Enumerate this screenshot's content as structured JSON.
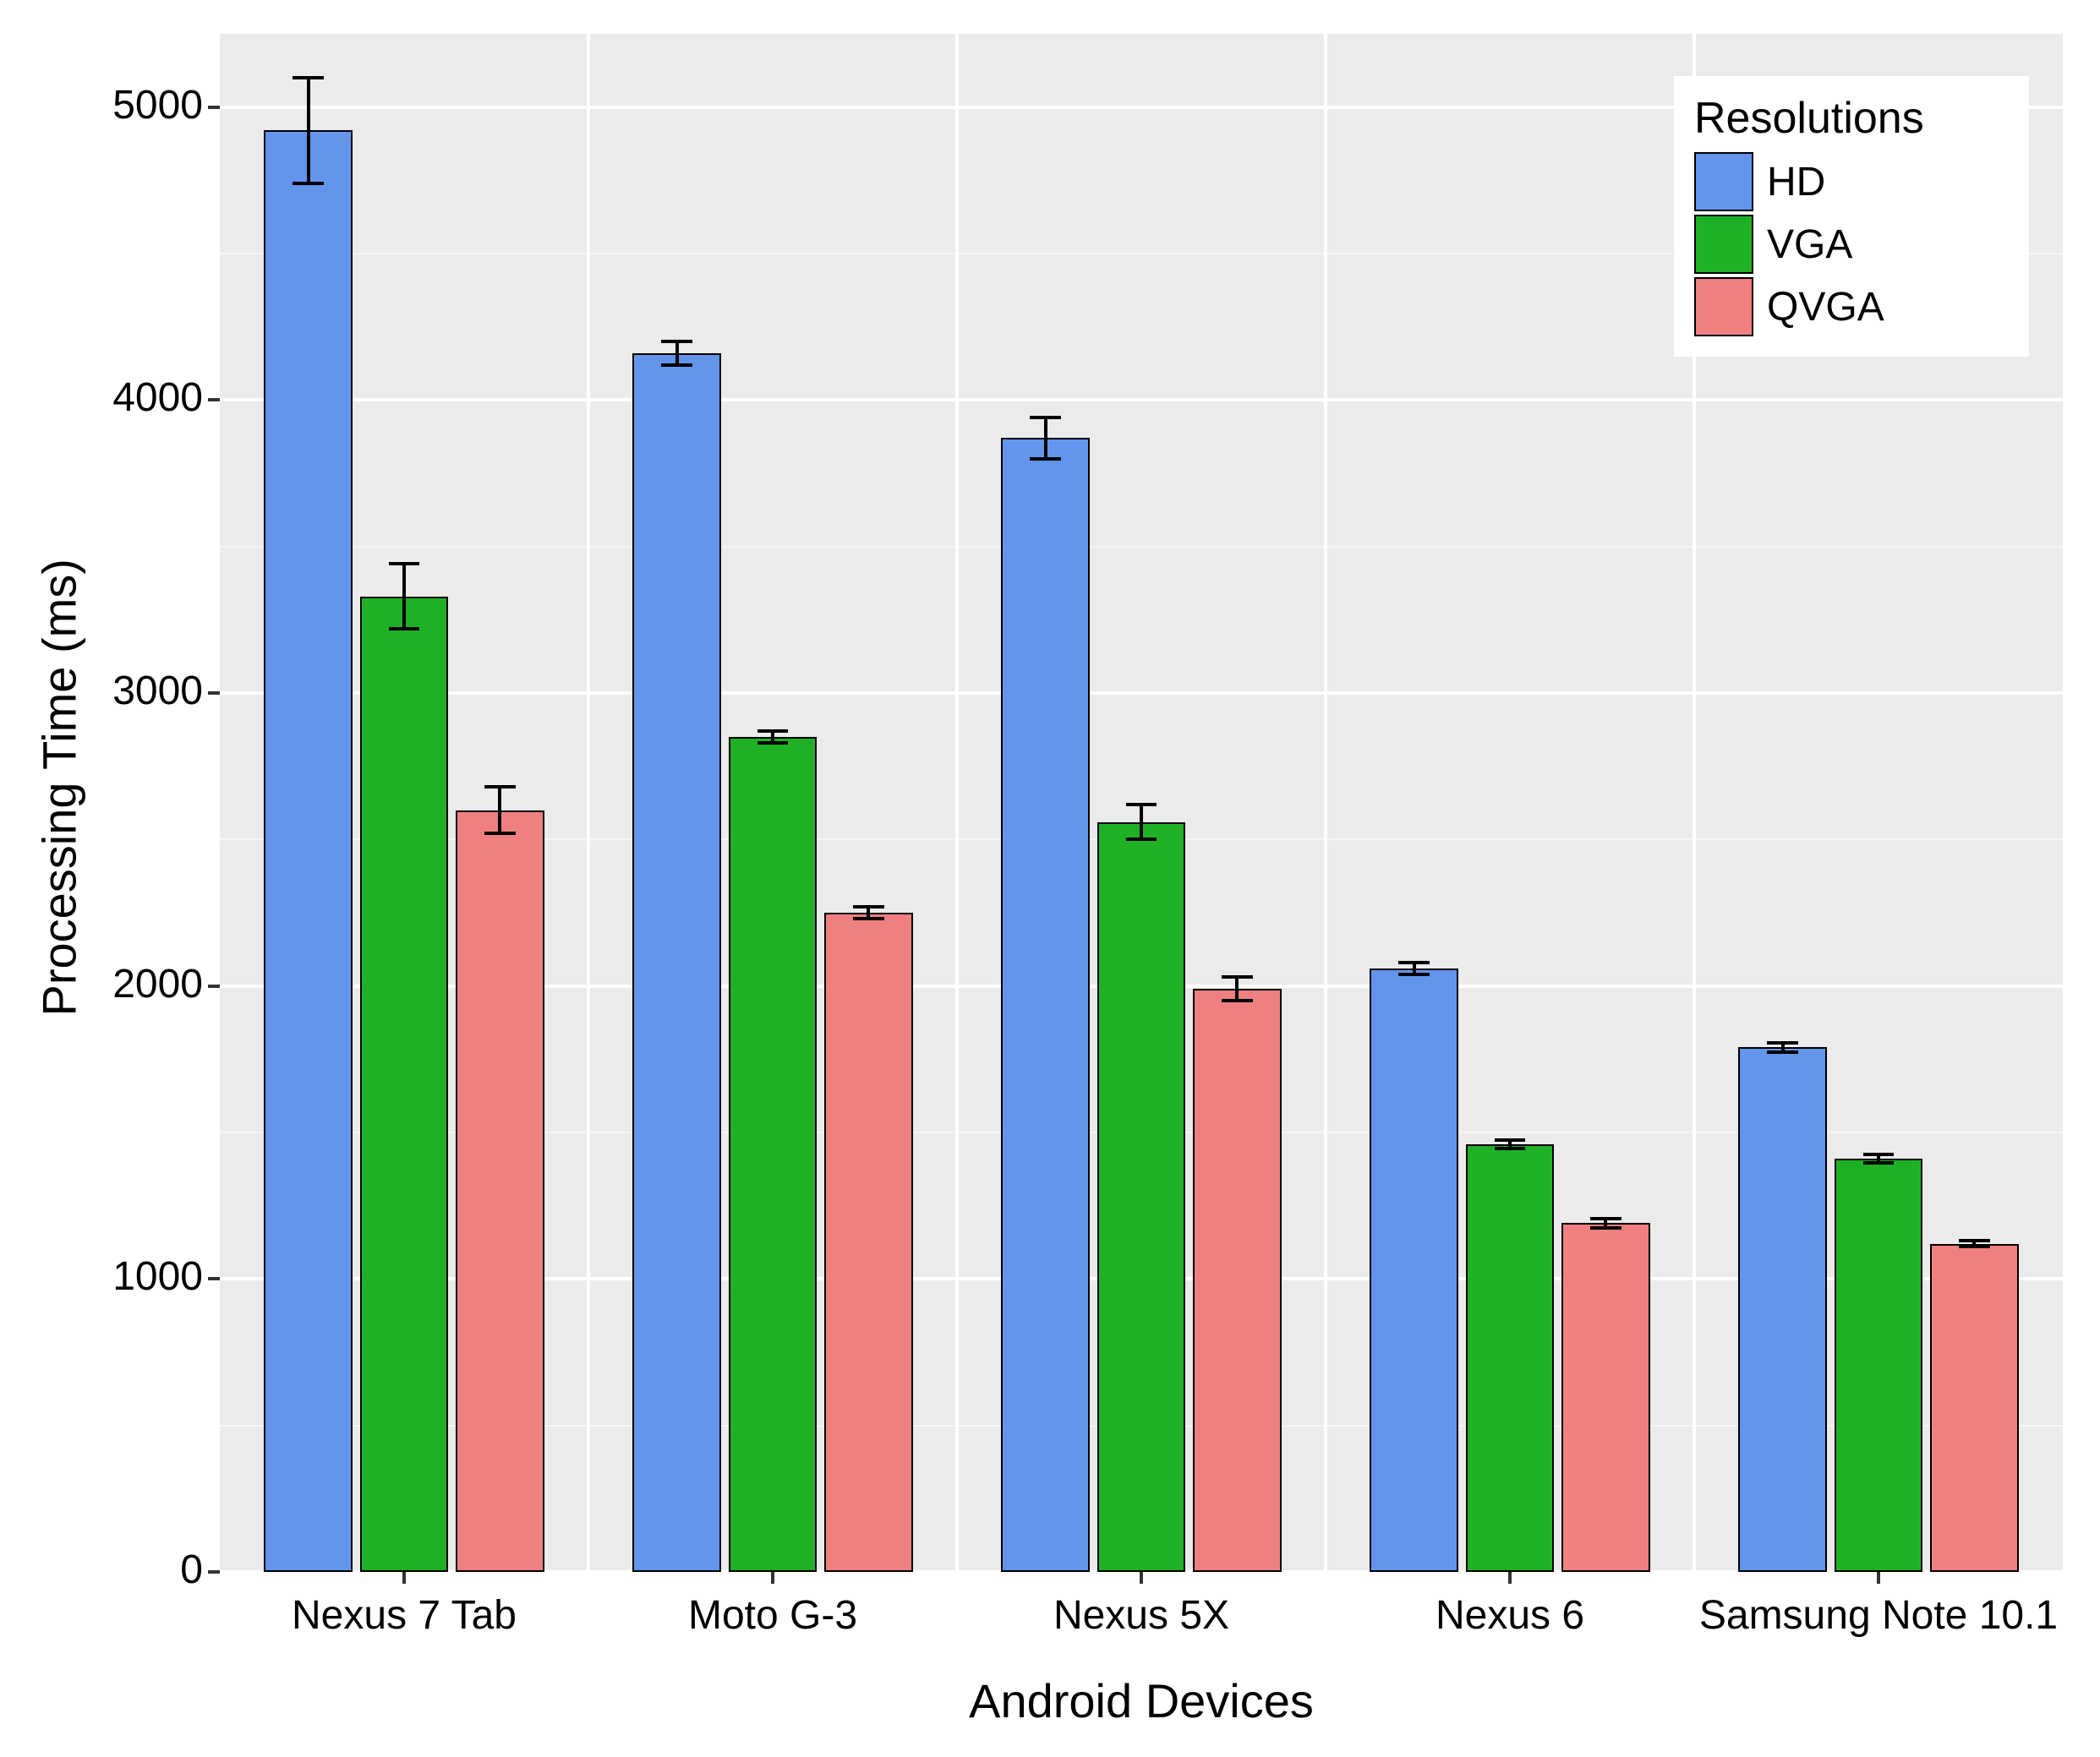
{
  "chart_data": {
    "type": "bar",
    "title": "",
    "xlabel": "Android Devices",
    "ylabel": "Processing Time (ms)",
    "ylim": [
      0,
      5250
    ],
    "y_ticks": [
      0,
      1000,
      2000,
      3000,
      4000,
      5000
    ],
    "categories": [
      "Nexus 7 Tab",
      "Moto G-3",
      "Nexus 5X",
      "Nexus 6",
      "Samsung Note 10.1"
    ],
    "series": [
      {
        "name": "HD",
        "color": "#6495ED",
        "values": [
          4920,
          4160,
          3870,
          2060,
          1790
        ],
        "errors": [
          180,
          40,
          70,
          20,
          15
        ]
      },
      {
        "name": "VGA",
        "color": "#20B026",
        "values": [
          3330,
          2850,
          2560,
          1460,
          1410
        ],
        "errors": [
          110,
          20,
          60,
          15,
          15
        ]
      },
      {
        "name": "QVGA",
        "color": "#F08080",
        "values": [
          2600,
          2250,
          1990,
          1190,
          1120
        ],
        "errors": [
          80,
          20,
          40,
          15,
          10
        ]
      }
    ],
    "legend": {
      "title": "Resolutions",
      "position": "top-right"
    }
  }
}
